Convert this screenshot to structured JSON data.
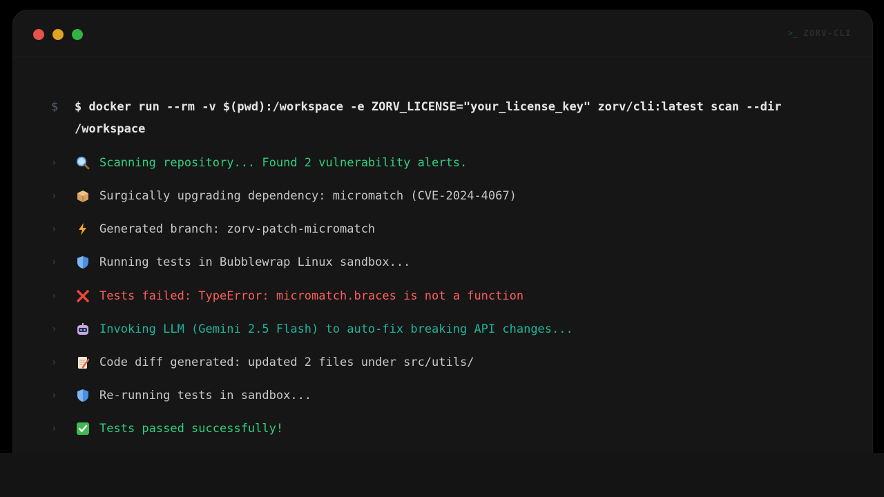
{
  "window": {
    "brand_label": "ZORV-CLI",
    "brand_prompt": ">_"
  },
  "command": {
    "sigil": "$",
    "text": "$ docker run --rm -v $(pwd):/workspace -e ZORV_LICENSE=\"your_license_key\" zorv/cli:latest scan --dir /workspace"
  },
  "log_lines": [
    {
      "icon": "magnifier-icon",
      "text": "Scanning repository... Found 2 vulnerability alerts.",
      "color": "#2fd080"
    },
    {
      "icon": "package-icon",
      "text": "Surgically upgrading dependency: micromatch (CVE-2024-4067)",
      "color": "#c8c8c8"
    },
    {
      "icon": "lightning-icon",
      "text": "Generated branch: zorv-patch-micromatch",
      "color": "#c8c8c8"
    },
    {
      "icon": "shield-icon",
      "text": "Running tests in Bubblewrap Linux sandbox...",
      "color": "#c8c8c8"
    },
    {
      "icon": "cross-icon",
      "text": "Tests failed: TypeError: micromatch.braces is not a function",
      "color": "#ff5c5c"
    },
    {
      "icon": "robot-icon",
      "text": "Invoking LLM (Gemini 2.5 Flash) to auto-fix breaking API changes...",
      "color": "#1fb59a"
    },
    {
      "icon": "memo-icon",
      "text": "Code diff generated: updated 2 files under src/utils/",
      "color": "#c8c8c8"
    },
    {
      "icon": "shield-icon",
      "text": "Re-running tests in sandbox...",
      "color": "#c8c8c8"
    },
    {
      "icon": "check-icon",
      "text": "Tests passed successfully!",
      "color": "#2fd080"
    }
  ],
  "chevron": "›"
}
